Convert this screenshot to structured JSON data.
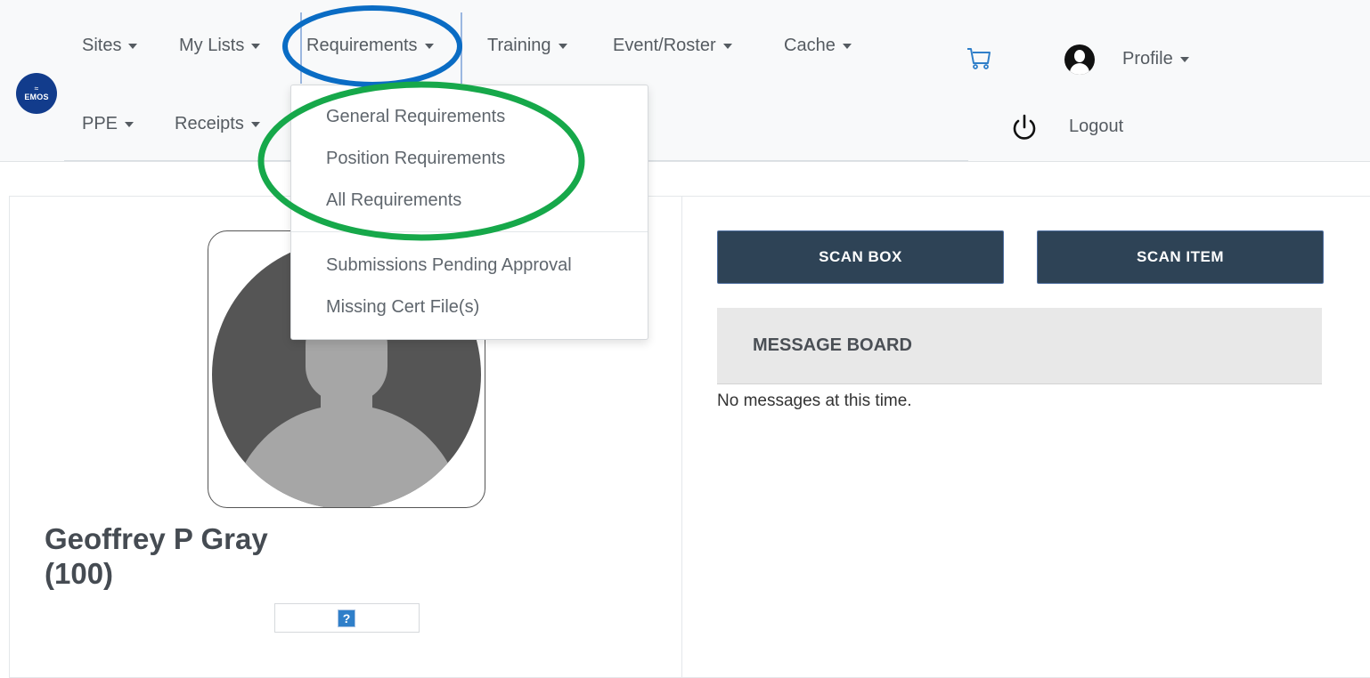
{
  "brand": {
    "logo_text": "EMOS"
  },
  "nav": {
    "sites": "Sites",
    "my_lists": "My Lists",
    "requirements": "Requirements",
    "training": "Training",
    "event_roster": "Event/Roster",
    "cache": "Cache",
    "ppe": "PPE",
    "receipts": "Receipts",
    "profile": "Profile",
    "logout": "Logout"
  },
  "requirements_menu": {
    "items": [
      "General Requirements",
      "Position Requirements",
      "All Requirements",
      "Submissions Pending Approval",
      "Missing Cert File(s)"
    ]
  },
  "user": {
    "name": "Geoffrey P Gray",
    "id": "(100)",
    "help_glyph": "?"
  },
  "actions": {
    "scan_box": "SCAN BOX",
    "scan_item": "SCAN ITEM"
  },
  "message_board": {
    "title": "MESSAGE BOARD",
    "empty_text": "No messages at this time."
  },
  "colors": {
    "button_bg": "#2e4356",
    "annotation_blue": "#0a6cc4",
    "annotation_green": "#16a84a",
    "logo_bg": "#123c8c"
  }
}
